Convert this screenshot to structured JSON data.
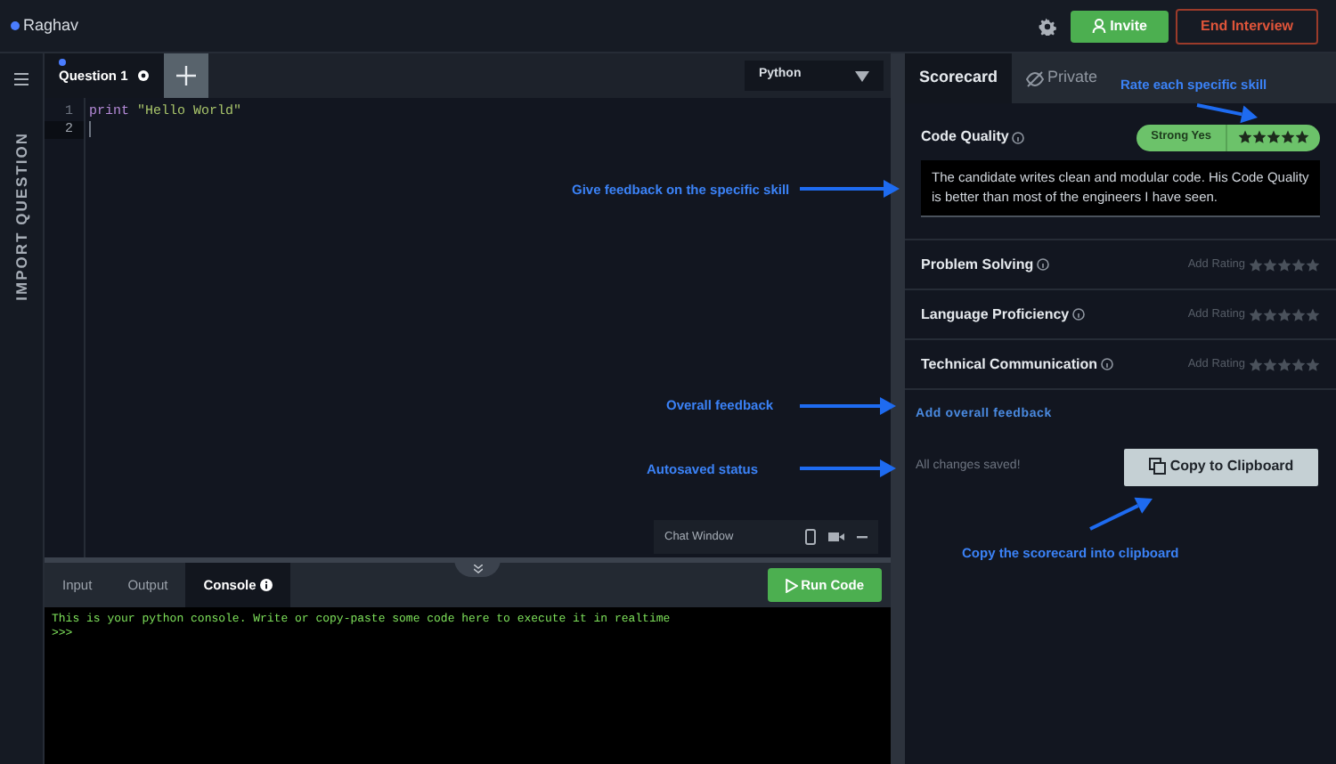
{
  "header": {
    "user": {
      "name": "Raghav",
      "color": "#4a7dff"
    },
    "invite_button": "Invite",
    "end_button": "End Interview"
  },
  "sidebar": {
    "label": "IMPORT QUESTION"
  },
  "editor": {
    "tabs": [
      {
        "label": "Question 1",
        "selected": true
      }
    ],
    "language": "Python",
    "lines": [
      {
        "number": "1",
        "current": false,
        "tokens": [
          {
            "kind": "keyword",
            "text": "print"
          },
          {
            "kind": "string",
            "text": "\"Hello World\""
          }
        ]
      },
      {
        "number": "2",
        "current": true
      }
    ],
    "chat_window": {
      "title": "Chat Window"
    }
  },
  "bottom": {
    "tabs": [
      {
        "label": "Input",
        "selected": false,
        "info": false
      },
      {
        "label": "Output",
        "selected": false,
        "info": false
      },
      {
        "label": "Console",
        "selected": true,
        "info": true
      }
    ],
    "run_button": "Run Code",
    "console": [
      "This is your python console. Write or copy-paste some code here to execute it in realtime",
      ">>>"
    ]
  },
  "scorecard": {
    "tabs": [
      {
        "label": "Scorecard",
        "selected": true
      },
      {
        "label": "Private",
        "selected": false
      }
    ],
    "skills": [
      {
        "kind": "rated",
        "name": "Code Quality",
        "verdict": "Strong Yes",
        "stars": 5,
        "feedback": "The candidate writes clean and modular code. His Code Quality is better than most of the engineers I have seen."
      },
      {
        "kind": "unrated",
        "name": "Problem Solving",
        "hint": "Add Rating",
        "stars": 0
      },
      {
        "kind": "unrated",
        "name": "Language Proficiency",
        "hint": "Add Rating",
        "stars": 0
      },
      {
        "kind": "unrated",
        "name": "Technical Communication",
        "hint": "Add Rating",
        "stars": 0
      }
    ],
    "overall_feedback_link": "Add overall feedback",
    "save_status": "All changes saved!",
    "copy_button": "Copy to Clipboard"
  },
  "annotations": [
    "Rate each specific skill",
    "Give feedback on the specific skill",
    "Overall feedback",
    "Autosaved status",
    "Copy the scorecard into clipboard"
  ]
}
